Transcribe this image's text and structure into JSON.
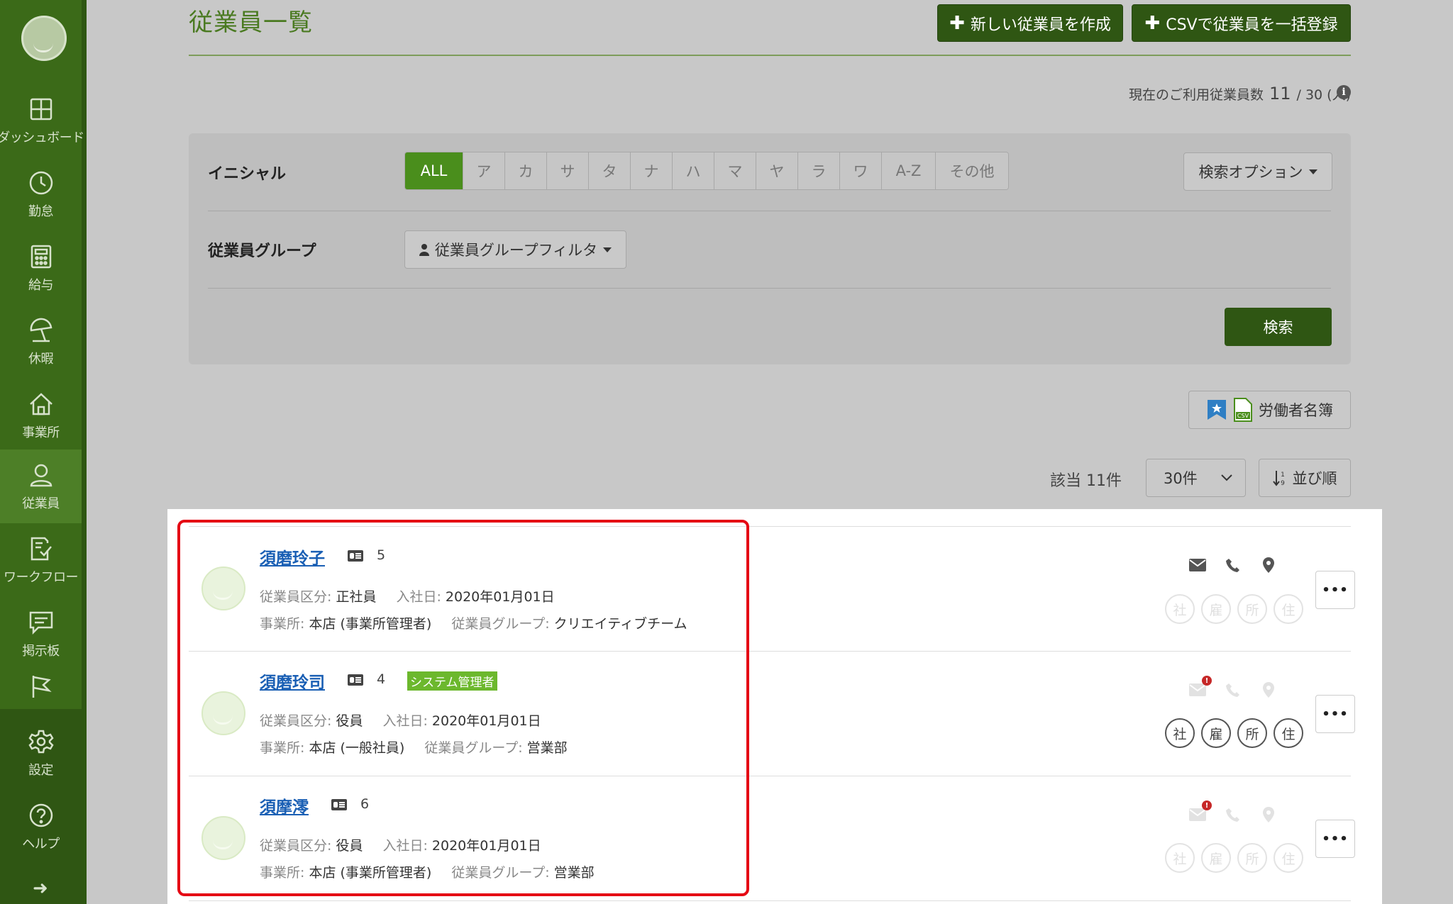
{
  "sidebar": {
    "items": [
      {
        "label": "ダッシュボード",
        "icon": "dashboard-icon"
      },
      {
        "label": "勤怠",
        "icon": "clock-icon"
      },
      {
        "label": "給与",
        "icon": "calculator-icon"
      },
      {
        "label": "休暇",
        "icon": "beach-umbrella-icon"
      },
      {
        "label": "事業所",
        "icon": "home-icon"
      },
      {
        "label": "従業員",
        "icon": "user-icon",
        "active": true
      },
      {
        "label": "ワークフロー",
        "icon": "checklist-icon"
      },
      {
        "label": "掲示板",
        "icon": "message-icon"
      },
      {
        "label": "",
        "icon": "flag-icon"
      },
      {
        "label": "設定",
        "icon": "gear-icon"
      },
      {
        "label": "ヘルプ",
        "icon": "help-icon"
      }
    ],
    "expand_icon": "arrow-right-icon"
  },
  "header": {
    "title": "従業員一覧",
    "create_button": "新しい従業員を作成",
    "csv_button": "CSVで従業員を一括登録",
    "usage_label": "現在のご利用従業員数",
    "usage_current": "11",
    "usage_sep": "/ 30 (人)"
  },
  "filter": {
    "initial_label": "イニシャル",
    "initials": [
      "ALL",
      "ア",
      "カ",
      "サ",
      "タ",
      "ナ",
      "ハ",
      "マ",
      "ヤ",
      "ラ",
      "ワ",
      "A-Z",
      "その他"
    ],
    "selected_initial": "ALL",
    "search_options": "検索オプション",
    "group_label": "従業員グループ",
    "group_filter": "従業員グループフィルタ",
    "search_button": "検索"
  },
  "toolbar": {
    "roster_button": "労働者名簿",
    "result_count": "該当 11件",
    "per_page": "30件",
    "sort_button": "並び順"
  },
  "employees": [
    {
      "name": "須磨玲子",
      "number": "5",
      "badge": "",
      "type_key": "従業員区分:",
      "type": "正社員",
      "join_key": "入社日:",
      "join_date": "2020年01月01日",
      "office_key": "事業所:",
      "office": "本店 (事業所管理者)",
      "group_key": "従業員グループ:",
      "group": "クリエイティブチーム",
      "docs": [
        "社",
        "雇",
        "所",
        "住"
      ],
      "docs_active": false,
      "email_alert": false,
      "contacts_active": true
    },
    {
      "name": "須磨玲司",
      "number": "4",
      "badge": "システム管理者",
      "type_key": "従業員区分:",
      "type": "役員",
      "join_key": "入社日:",
      "join_date": "2020年01月01日",
      "office_key": "事業所:",
      "office": "本店 (一般社員)",
      "group_key": "従業員グループ:",
      "group": "営業部",
      "docs": [
        "社",
        "雇",
        "所",
        "住"
      ],
      "docs_active": true,
      "email_alert": true,
      "contacts_active": false
    },
    {
      "name": "須摩澪",
      "number": "6",
      "badge": "",
      "type_key": "従業員区分:",
      "type": "役員",
      "join_key": "入社日:",
      "join_date": "2020年01月01日",
      "office_key": "事業所:",
      "office": "本店 (事業所管理者)",
      "group_key": "従業員グループ:",
      "group": "営業部",
      "docs": [
        "社",
        "雇",
        "所",
        "住"
      ],
      "docs_active": false,
      "email_alert": true,
      "contacts_active": false
    }
  ],
  "colors": {
    "sidebar": "#3b6a18",
    "primary_button": "#2f5613",
    "accent_green": "#4a8e1c",
    "admin_badge": "#6cb82d",
    "link": "#1a5fb4",
    "highlight": "#e50914"
  }
}
